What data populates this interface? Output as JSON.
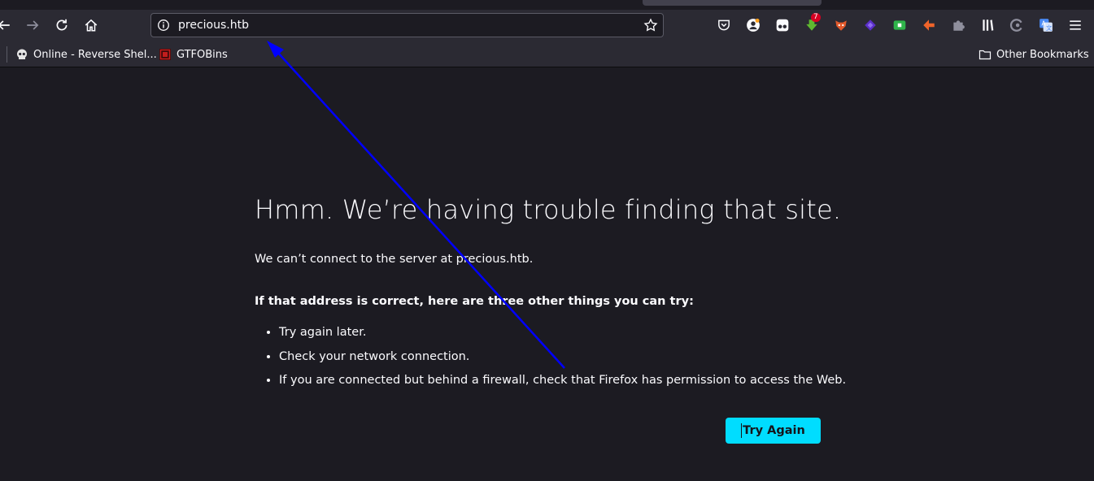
{
  "browser": {
    "url": "precious.htb",
    "nav": {
      "back_icon": "back-arrow-icon",
      "forward_icon": "forward-arrow-icon",
      "reload_icon": "reload-icon",
      "home_icon": "home-icon"
    },
    "extensions_badge_count": "7",
    "extension_icons": [
      "pocket-icon",
      "account-icon",
      "extension-glasses-icon",
      "download-extension-icon",
      "fox-extension-icon",
      "purple-extension-icon",
      "green-extension-icon",
      "orange-extension-icon",
      "puzzle-extension-icon",
      "library-icon",
      "spinner-extension-icon",
      "translate-icon",
      "menu-icon"
    ]
  },
  "bookmarks": {
    "items": [
      {
        "label": "Online - Reverse Shel...",
        "icon": "skull-icon"
      },
      {
        "label": "GTFOBins",
        "icon": "gtfobins-icon"
      }
    ],
    "other_label": "Other Bookmarks"
  },
  "error_page": {
    "title": "Hmm. We’re having trouble finding that site.",
    "description": "We can’t connect to the server at precious.htb.",
    "subtitle": "If that address is correct, here are three other things you can try:",
    "suggestions": [
      "Try again later.",
      "Check your network connection.",
      "If you are connected but behind a firewall, check that Firefox has permission to access the Web."
    ],
    "try_again_label": "Try Again"
  },
  "colors": {
    "page_bg": "#1c1b22",
    "toolbar_bg": "#2b2a33",
    "button_accent": "#00ddff",
    "annotation_arrow": "#0000ff"
  }
}
